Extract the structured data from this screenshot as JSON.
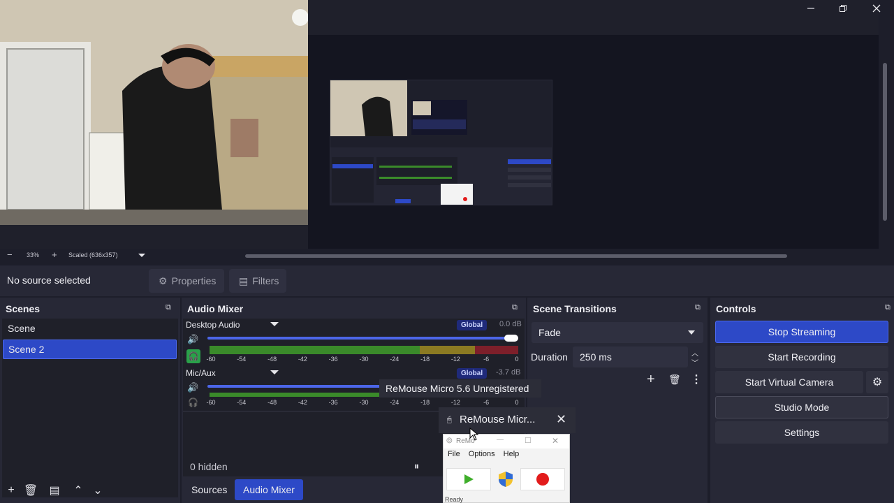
{
  "window": {
    "minimize_icon": "minimize-icon",
    "maximize_icon": "restore-icon",
    "close_icon": "close-icon"
  },
  "preview": {
    "zoom_level": "33%",
    "scale_mode": "Scaled (636x357)"
  },
  "context_bar": {
    "no_source": "No source selected",
    "properties": "Properties",
    "filters": "Filters"
  },
  "scenes": {
    "title": "Scenes",
    "items": [
      {
        "label": "Scene",
        "selected": false
      },
      {
        "label": "Scene 2",
        "selected": true
      }
    ]
  },
  "mixer": {
    "title": "Audio Mixer",
    "channels": [
      {
        "name": "Desktop Audio",
        "global": "Global",
        "db": "0.0 dB",
        "volume": 1.0,
        "monitoring": true
      },
      {
        "name": "Mic/Aux",
        "global": "Global",
        "db": "-3.7 dB",
        "volume": 0.78,
        "monitoring": false
      }
    ],
    "ticks": [
      "-60",
      "-54",
      "-48",
      "-42",
      "-36",
      "-30",
      "-24",
      "-18",
      "-12",
      "-6",
      "0"
    ],
    "hidden_label": "0 hidden"
  },
  "tabs": {
    "sources": "Sources",
    "audio_mixer": "Audio Mixer"
  },
  "transitions": {
    "title": "Scene Transitions",
    "selected": "Fade",
    "duration_label": "Duration",
    "duration_value": "250 ms"
  },
  "controls": {
    "title": "Controls",
    "stop_streaming": "Stop Streaming",
    "start_recording": "Start Recording",
    "start_virtual_camera": "Start Virtual Camera",
    "studio_mode": "Studio Mode",
    "settings": "Settings"
  },
  "remouse": {
    "tooltip": "ReMouse Micro 5.6 Unregistered",
    "thumb_title": "ReMouse Micr...",
    "window_title": "ReMo",
    "menu": [
      "File",
      "Options",
      "Help"
    ],
    "status": "Ready"
  },
  "colors": {
    "accent": "#2d49c7",
    "meter_green": "#3a8a2a",
    "meter_yellow": "#8b7a22",
    "meter_red": "#7d1f2a"
  }
}
